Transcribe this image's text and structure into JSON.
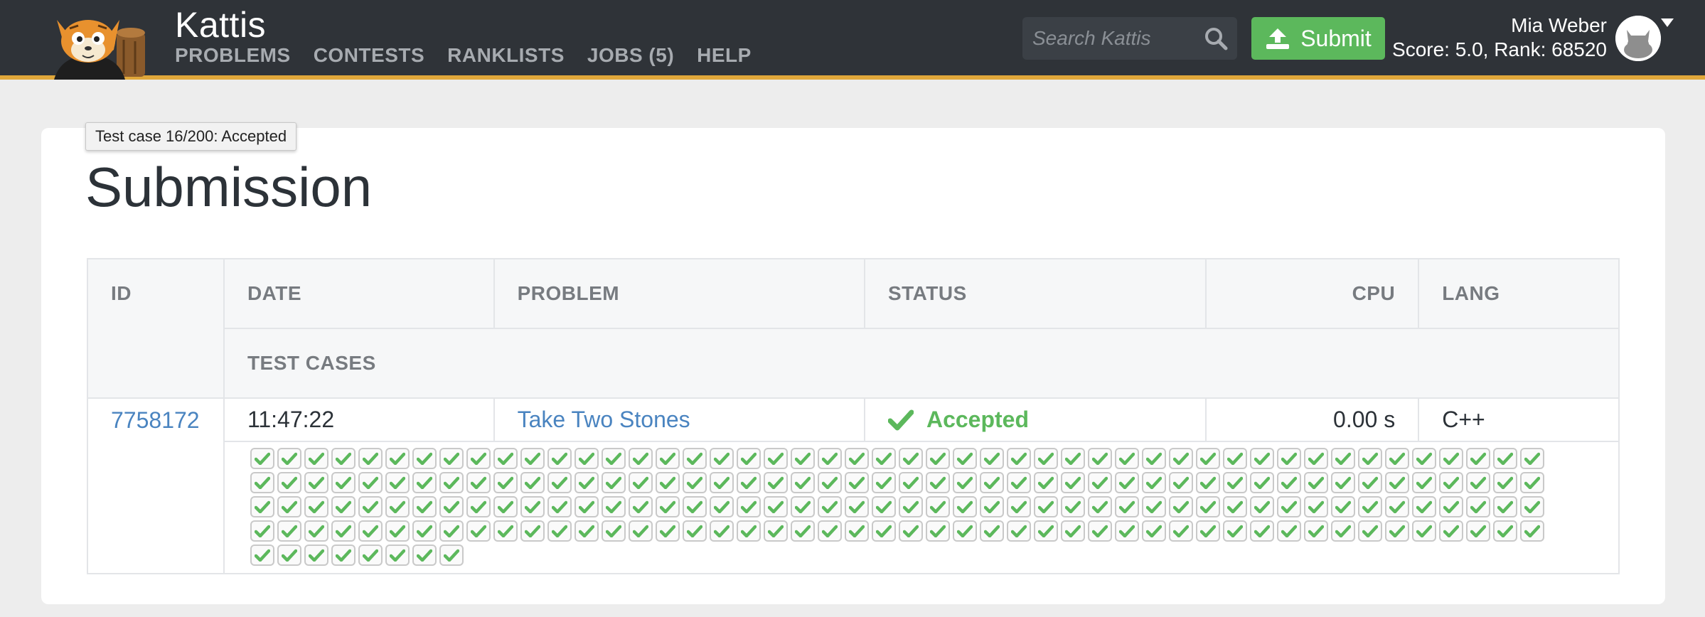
{
  "app": {
    "brand": "Kattis",
    "nav": [
      "PROBLEMS",
      "CONTESTS",
      "RANKLISTS",
      "JOBS (5)",
      "HELP"
    ],
    "search_placeholder": "Search Kattis",
    "submit_label": "Submit",
    "user_name": "Mia Weber",
    "user_score": "Score: 5.0, Rank: 68520"
  },
  "tooltip": "Test case 16/200: Accepted",
  "page_title": "Submission",
  "table": {
    "headers": {
      "id": "ID",
      "date": "DATE",
      "problem": "PROBLEM",
      "status": "STATUS",
      "cpu": "CPU",
      "lang": "LANG",
      "test_cases": "TEST CASES"
    },
    "row": {
      "id": "7758172",
      "date": "11:47:22",
      "problem": "Take Two Stones",
      "status": "Accepted",
      "cpu": "0.00 s",
      "lang": "C++"
    },
    "test_case_count": 200,
    "test_case_status": "accepted"
  },
  "colors": {
    "header_bg": "#2f3338",
    "accent_bar": "#e0a73a",
    "submit_green": "#5cb85c",
    "link_blue": "#4a84c0",
    "accepted_green": "#5cb85c"
  },
  "icons": [
    "kattis-cat-logo",
    "search-icon",
    "upload-icon",
    "avatar-icon",
    "caret-down-icon",
    "check-icon"
  ]
}
